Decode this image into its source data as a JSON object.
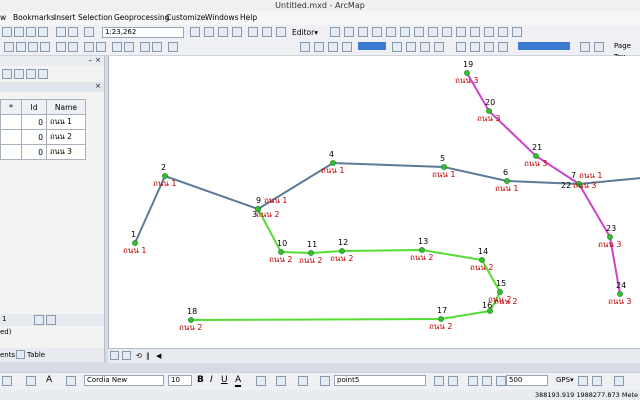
{
  "window": {
    "title": "Untitled.mxd - ArcMap"
  },
  "menu": [
    "w",
    "Bookmarks",
    "Insert",
    "Selection",
    "Geoprocessing",
    "Customize",
    "Windows",
    "Help"
  ],
  "toolbar": {
    "scale": "1:23,262",
    "editor_label": "Editor▾",
    "page_text": "Page Tex"
  },
  "toc": {
    "columns": [
      "*",
      "Id",
      "Name"
    ],
    "rows": [
      {
        "id": "0",
        "name": "ถนน 1"
      },
      {
        "id": "0",
        "name": "ถนน 2"
      },
      {
        "id": "0",
        "name": "ถนน 3"
      }
    ],
    "nav_record": "1",
    "side_text": "ed)",
    "tab_contents": "ents",
    "tab_table": "Table"
  },
  "drawing": {
    "font": "Cordia New",
    "font_size": "10",
    "bold": "B",
    "italic": "I",
    "underline": "U",
    "layer": "point5",
    "scale_value": "500",
    "gps": "GPS▾"
  },
  "status": {
    "coords": "388193.919  1988277.873 Mete"
  },
  "map": {
    "colors": {
      "road1": "#5c7a99",
      "road2": "#55dd33",
      "road3": "#cc44cc",
      "point": "#2ec02e"
    },
    "points": [
      {
        "id": "1",
        "name": "ถนน 1"
      },
      {
        "id": "2",
        "name": "ถนน 1"
      },
      {
        "id": "3",
        "name": "ถนน 2"
      },
      {
        "id": "4",
        "name": "ถนน 1"
      },
      {
        "id": "5",
        "name": "ถนน 1"
      },
      {
        "id": "6",
        "name": "ถนน 1"
      },
      {
        "id": "7",
        "name": "ถนน 1"
      },
      {
        "id": "9",
        "name": "ถนน 1"
      },
      {
        "id": "10",
        "name": "ถนน 2"
      },
      {
        "id": "11",
        "name": "ถนน 2"
      },
      {
        "id": "12",
        "name": "ถนน 2"
      },
      {
        "id": "13",
        "name": "ถนน 2"
      },
      {
        "id": "14",
        "name": "ถนน 2"
      },
      {
        "id": "15",
        "name": "ถนน 2"
      },
      {
        "id": "16",
        "name": "ถนน 2"
      },
      {
        "id": "17",
        "name": "ถนน 2"
      },
      {
        "id": "18",
        "name": "ถนน 2"
      },
      {
        "id": "19",
        "name": "ถนน 3"
      },
      {
        "id": "20",
        "name": "ถนน 3"
      },
      {
        "id": "21",
        "name": "ถนน 3"
      },
      {
        "id": "22",
        "name": "ถนน 3"
      },
      {
        "id": "23",
        "name": "ถนน 3"
      },
      {
        "id": "24",
        "name": "ถนน 3"
      }
    ]
  }
}
